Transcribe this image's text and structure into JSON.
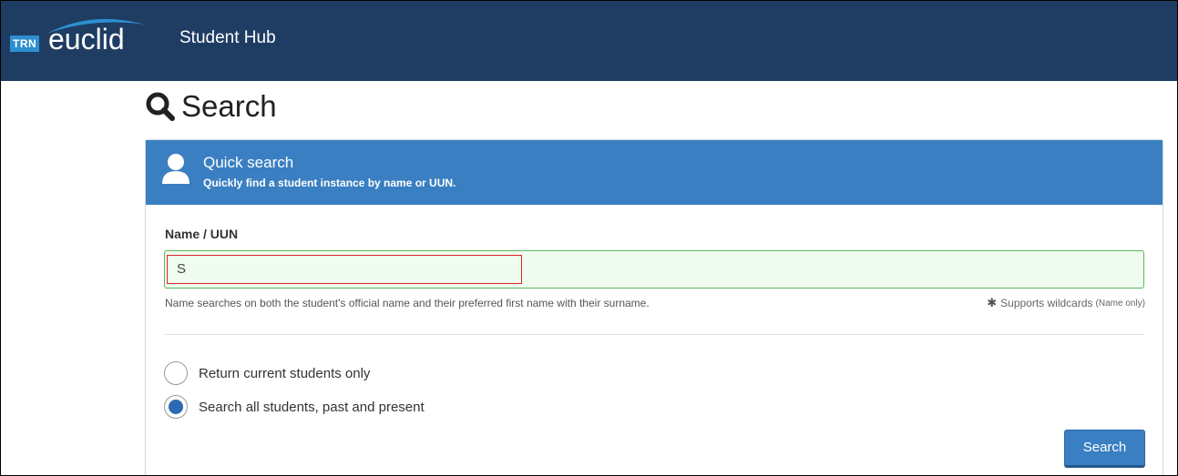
{
  "header": {
    "logo_badge": "TRN",
    "logo_word": "euclid",
    "app_title": "Student Hub"
  },
  "page": {
    "title": "Search",
    "title_icon": "search-icon"
  },
  "panel": {
    "title": "Quick search",
    "subtitle": "Quickly find a student instance by name or UUN.",
    "icon": "user-icon"
  },
  "form": {
    "field_label": "Name / UUN",
    "input_value": "S",
    "help_text": "Name searches on both the student's official name and their preferred first name with their surname.",
    "wildcard_text": "Supports wildcards",
    "wildcard_note": "(Name only)",
    "radios": [
      {
        "label": "Return current students only",
        "checked": false
      },
      {
        "label": "Search all students, past and present",
        "checked": true
      }
    ],
    "search_button": "Search"
  },
  "colors": {
    "topbar": "#1f3d63",
    "accent": "#3a7fc1",
    "input_success_bg": "#effcef",
    "input_success_border": "#59b85a",
    "highlight_border": "#d9262a"
  }
}
